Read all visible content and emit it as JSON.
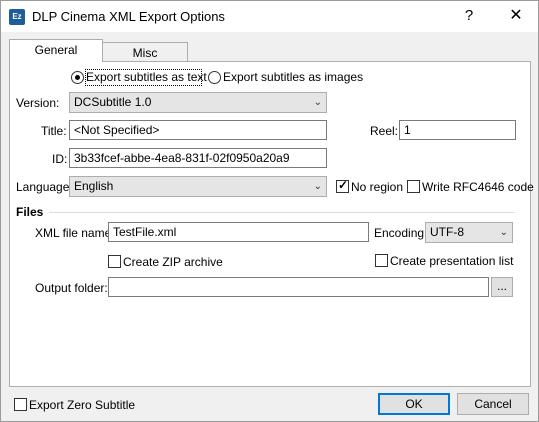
{
  "window": {
    "title": "DLP Cinema XML Export Options",
    "app_icon_text": "Ez",
    "help_glyph": "?",
    "close_glyph": "✕"
  },
  "tabs": [
    {
      "label": "General",
      "active": true
    },
    {
      "label": "Misc",
      "active": false
    }
  ],
  "general": {
    "export_mode": {
      "text_label": "Export subtitles as text",
      "images_label": "Export subtitles as images",
      "selected": "text"
    },
    "version": {
      "label": "Version:",
      "value": "DCSubtitle 1.0"
    },
    "title": {
      "label": "Title:",
      "value": "<Not Specified>"
    },
    "reel": {
      "label": "Reel:",
      "value": "1"
    },
    "id": {
      "label": "ID:",
      "value": "3b33fcef-abbe-4ea8-831f-02f0950a20a9"
    },
    "language": {
      "label": "Language:",
      "value": "English"
    },
    "no_region": {
      "label": "No region",
      "checked": true
    },
    "write_rfc": {
      "label": "Write RFC4646 code",
      "checked": false
    }
  },
  "files": {
    "section_label": "Files",
    "xml_file_name": {
      "label": "XML file name:",
      "value": "TestFile.xml"
    },
    "encoding": {
      "label": "Encoding:",
      "value": "UTF-8"
    },
    "create_zip": {
      "label": "Create ZIP archive",
      "checked": false
    },
    "create_presentation_list": {
      "label": "Create presentation list",
      "checked": false
    },
    "output_folder": {
      "label": "Output folder:",
      "value": ""
    },
    "browse_label": "..."
  },
  "footer": {
    "export_zero": {
      "label": "Export Zero Subtitle",
      "checked": false
    },
    "ok_label": "OK",
    "cancel_label": "Cancel"
  },
  "colors": {
    "accent": "#0078d7",
    "dialog_bg": "#f0f0f0"
  }
}
